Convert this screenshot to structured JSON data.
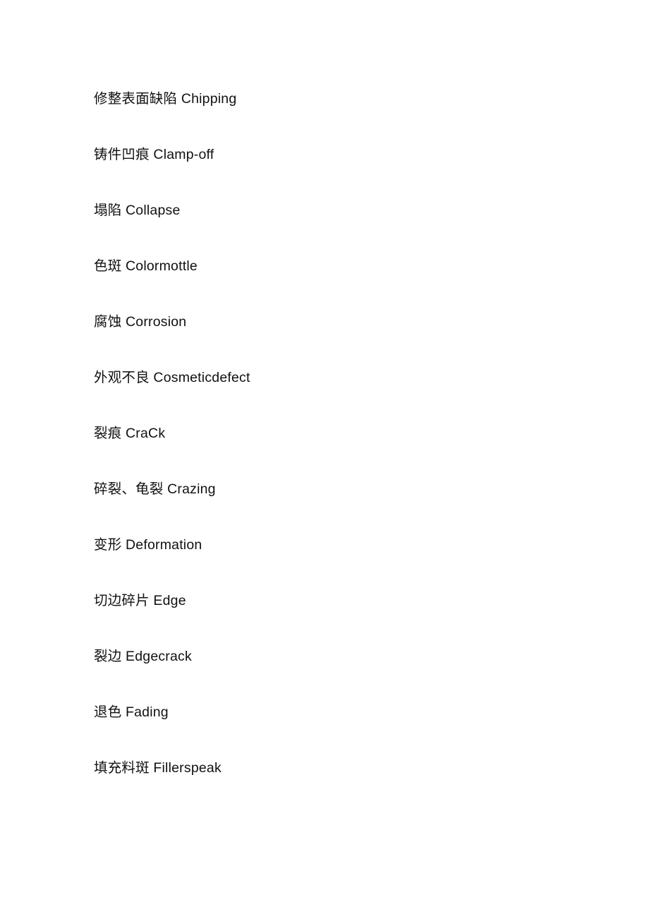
{
  "document": {
    "page_background": "#ffffff",
    "text_color": "#111111",
    "lines": [
      {
        "zh": "修整表面缺陷",
        "en": "Chipping",
        "text": "修整表面缺陷 Chipping"
      },
      {
        "zh": "铸件凹痕",
        "en": "Clamp-off",
        "text": "铸件凹痕 Clamp-off"
      },
      {
        "zh": "塌陷",
        "en": "Collapse",
        "text": "塌陷 Collapse"
      },
      {
        "zh": "色斑",
        "en": "Colormottle",
        "text": "色斑 Colormottle"
      },
      {
        "zh": "腐蚀",
        "en": "Corrosion",
        "text": "腐蚀 Corrosion"
      },
      {
        "zh": "外观不良",
        "en": "Cosmeticdefect",
        "text": "外观不良 Cosmeticdefect"
      },
      {
        "zh": "裂痕",
        "en": "CraCk",
        "text": "裂痕 CraCk"
      },
      {
        "zh": "碎裂、龟裂",
        "en": "Crazing",
        "text": "碎裂、龟裂 Crazing"
      },
      {
        "zh": "变形",
        "en": "Deformation",
        "text": "变形 Deformation"
      },
      {
        "zh": "切边碎片",
        "en": "Edge",
        "text": "切边碎片 Edge"
      },
      {
        "zh": "裂边",
        "en": "Edgecrack",
        "text": "裂边 Edgecrack"
      },
      {
        "zh": "退色",
        "en": "Fading",
        "text": "退色 Fading"
      },
      {
        "zh": "填充料斑",
        "en": "Fillerspeak",
        "text": "填充料斑 Fillerspeak"
      }
    ]
  }
}
